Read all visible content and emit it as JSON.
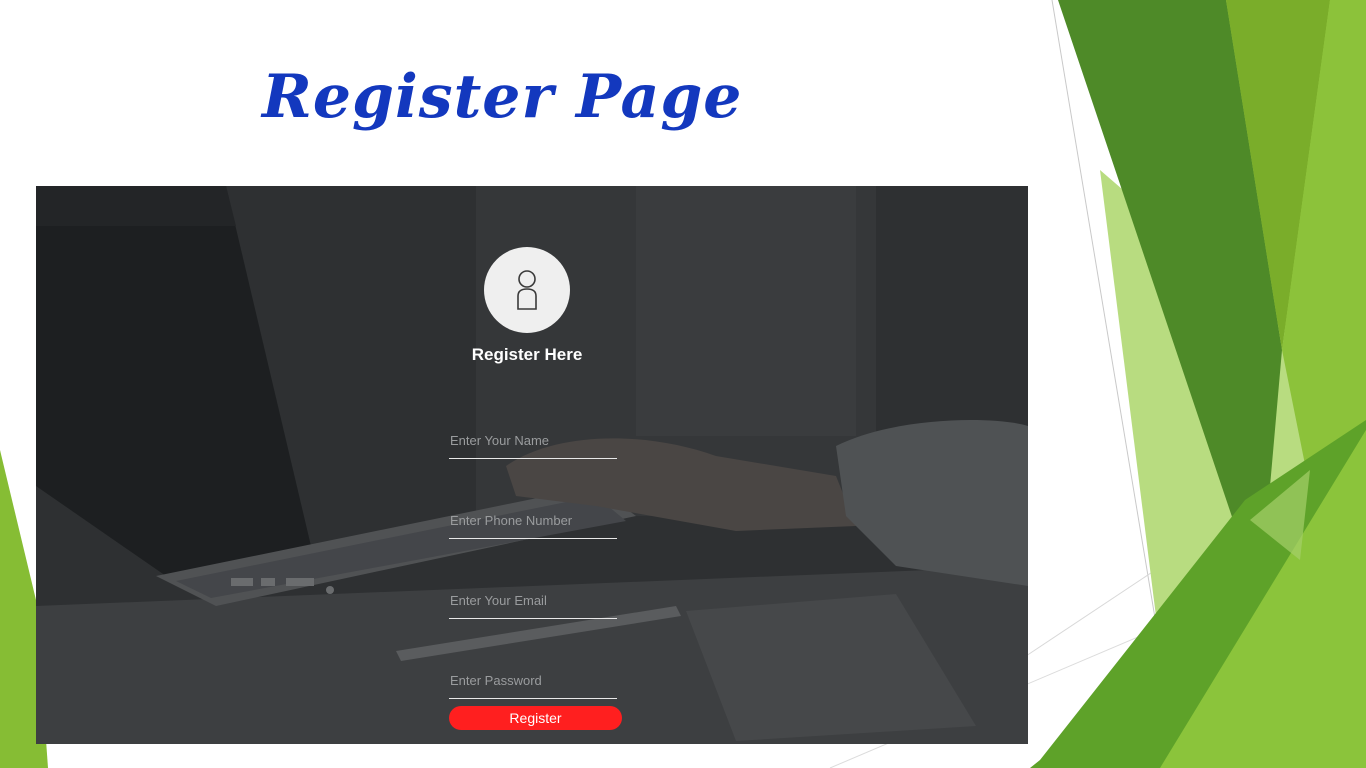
{
  "slide": {
    "title": "Register Page"
  },
  "form": {
    "heading": "Register Here",
    "fields": [
      {
        "placeholder": "Enter Your Name"
      },
      {
        "placeholder": "Enter Phone Number"
      },
      {
        "placeholder": "Enter Your Email"
      },
      {
        "placeholder": "Enter Password"
      }
    ],
    "submit_label": "Register",
    "avatar_icon": "user-icon"
  },
  "colors": {
    "title": "#1338be",
    "button": "#ff1f1f",
    "overlay": "#2b2d2f",
    "green_dark": "#4e8a28",
    "green_mid": "#7db32a",
    "green_light": "#a7d260"
  }
}
